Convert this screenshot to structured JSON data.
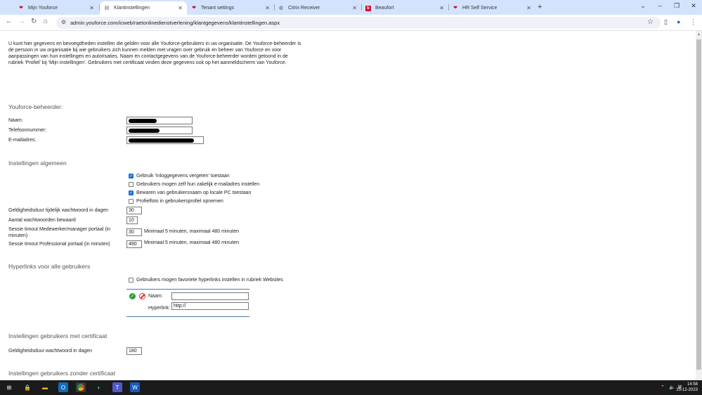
{
  "browser": {
    "tabs": [
      {
        "label": "Mijn Youforce",
        "icon": "youforce-logo-icon",
        "active": false
      },
      {
        "label": "Klantinstellingen",
        "icon": "page-icon",
        "active": true
      },
      {
        "label": "Tenant settings",
        "icon": "youforce-logo-icon",
        "active": false
      },
      {
        "label": "Citrix Receiver",
        "icon": "globe-icon",
        "active": false
      },
      {
        "label": "Beaufort",
        "icon": "beaufort-logo-icon",
        "active": false
      },
      {
        "label": "HR Self Service",
        "icon": "hr-logo-icon",
        "active": false
      }
    ],
    "url": "admin.youforce.com/icweb/raetonlinedienstverlening/klantgegevens/klantinstellingen.aspx",
    "accent_color": "#d3e3fd"
  },
  "page": {
    "intro": "U kunt hier gegevens en bevoegdheden instellen die gelden voor alle Youforce-gebruikers in uw organisatie. De Youforce-beheerder is de persoon in uw organisatie bij wie gebruikers zich kunnen melden met vragen over gebruik en beheer van Youforce en voor aanpassingen van hun instellingen en autorisaties. Naam en contactgegevens van de Youforce-beheerder worden getoond in de rubriek 'Profiel' bij 'Mijn instellingen'. Gebruikers met certificaat vinden deze gegevens ook op het aanmeldscherm van Youforce.",
    "admin": {
      "title": "Youforce-beheerder:",
      "name_label": "Naam:",
      "phone_label": "Telefoonnummer:",
      "email_label": "E-mailadres:"
    },
    "general": {
      "title": "Instellingen algemeen",
      "checkboxes": [
        {
          "label": "Gebruik 'Inloggegevens vergeten' toestaan",
          "checked": true
        },
        {
          "label": "Gebruikers mogen zelf hun zakelijk e-mailadres instellen",
          "checked": false
        },
        {
          "label": "Bewaren van gebruikersnaam op locale PC toestaan",
          "checked": true
        },
        {
          "label": "Profielfoto in gebruikersprofiel opnemen",
          "checked": false
        }
      ],
      "temp_pw_label": "Geldigheidsduur tijdelijk wachtwoord in dagen",
      "temp_pw_value": "30",
      "pw_count_label": "Aantal wachtwoorden bewaard",
      "pw_count_value": "10",
      "session_emp_label": "Sessie timout Medewerker/manager portaal (in minuten)",
      "session_emp_value": "30",
      "session_emp_hint": "Minimaal 5 minuten, maximaal 480 minuten",
      "session_pro_label": "Sessie timout Professional portaal (in minuten)",
      "session_pro_value": "480",
      "session_pro_hint": "Minimaal 5 minuten, maximaal 480 minuten"
    },
    "hyperlinks": {
      "title": "Hyperlinks voor alle gebruikers",
      "checkbox_label": "Gebruikers mogen favoriete hyperlinks instellen in rubriek Websites",
      "checkbox_checked": false,
      "name_label": "Naam:",
      "name_value": "",
      "link_label": "Hyperlink:",
      "link_value": "http://"
    },
    "cert": {
      "title": "Instellingen gebruikers met certificaat",
      "pw_label": "Geldigheidsduur wachtwoord in dagen",
      "pw_value": "180"
    },
    "nocert": {
      "title": "Instellingen gebruikers zonder certificaat"
    }
  },
  "taskbar": {
    "time": "14:58",
    "date": "15-12-2023"
  }
}
